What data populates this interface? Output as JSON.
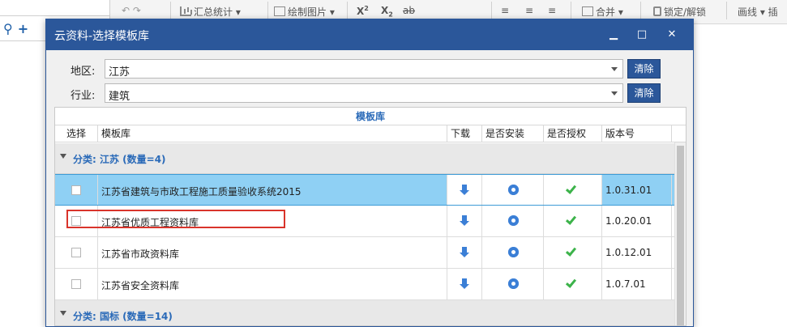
{
  "background_app": {
    "toolbar": {
      "summary_stats": "汇总统计",
      "draw_image": "绘制图片",
      "superscript": "X",
      "superscript_mark": "2",
      "subscript": "X",
      "subscript_mark": "2",
      "strike": "ab",
      "merge": "合并",
      "lock_unlock": "锁定/解锁",
      "draw_line": "画线",
      "insert_partial": "插"
    }
  },
  "dialog": {
    "title": "云资料-选择模板库",
    "minimize_icon": "minimize-icon",
    "maximize_icon": "maximize-icon",
    "close_icon": "close-icon",
    "filters": {
      "region_label": "地区:",
      "region_value": "江苏",
      "industry_label": "行业:",
      "industry_value": "建筑",
      "clear_label": "清除"
    },
    "grid": {
      "caption": "模板库",
      "columns": [
        "选择",
        "模板库",
        "下载",
        "是否安装",
        "是否授权",
        "版本号"
      ],
      "groups": [
        {
          "label": "分类: 江苏 (数量=4)"
        },
        {
          "label": "分类: 国标 (数量=14)"
        }
      ],
      "rows": [
        {
          "name": "江苏省建筑与市政工程施工质量验收系统2015",
          "version": "1.0.31.01",
          "selected": true
        },
        {
          "name": "江苏省优质工程资料库",
          "version": "1.0.20.01",
          "selected": false
        },
        {
          "name": "江苏省市政资料库",
          "version": "1.0.12.01",
          "selected": false
        },
        {
          "name": "江苏省安全资料库",
          "version": "1.0.7.01",
          "selected": false
        }
      ]
    }
  }
}
